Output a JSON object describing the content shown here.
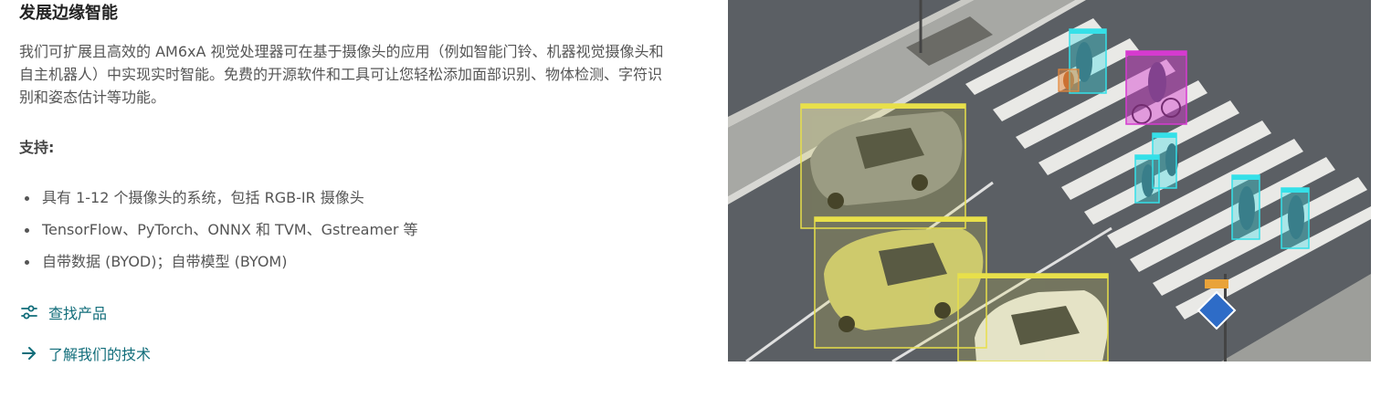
{
  "section": {
    "title": "发展边缘智能",
    "description": "我们可扩展且高效的 AM6xA 视觉处理器可在基于摄像头的应用（例如智能门铃、机器视觉摄像头和自主机器人）中实现实时智能。免费的开源软件和工具可让您轻松添加面部识别、物体检测、字符识别和姿态估计等功能。",
    "support_label": "支持:",
    "features": [
      "具有 1-12 个摄像头的系统，包括 RGB-IR 摄像头",
      "TensorFlow、PyTorch、ONNX 和 TVM、Gstreamer 等",
      "自带数据 (BYOD)；自带模型 (BYOM)"
    ]
  },
  "links": {
    "find_products": {
      "label": "查找产品",
      "icon": "sliders-icon"
    },
    "learn_tech": {
      "label": "了解我们的技术",
      "icon": "arrow-right-icon"
    }
  },
  "image": {
    "description": "aerial-street-object-detection",
    "colors": {
      "car_box": "#e8e04a",
      "person_box": "#35e0e8",
      "cyclist_box": "#d63ad0"
    }
  },
  "colors": {
    "link": "#116d7a",
    "title": "#222222",
    "text": "#555555"
  }
}
